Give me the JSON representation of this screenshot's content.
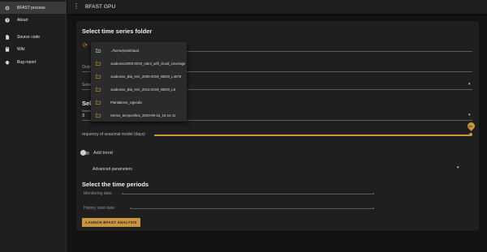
{
  "sidebar": {
    "items": [
      {
        "label": "BFAST process",
        "icon": "gear-icon"
      },
      {
        "label": "About",
        "icon": "help-icon"
      },
      {
        "label": "Source code",
        "icon": "file-icon"
      },
      {
        "label": "Wiki",
        "icon": "book-icon"
      },
      {
        "label": "Bug report",
        "icon": "bug-icon"
      }
    ]
  },
  "header": {
    "title": "BFAST GPU",
    "menu_icon": "kebab-menu-icon"
  },
  "form": {
    "folder_title": "Select time series folder",
    "output_label": "Outp",
    "select_label": "Selec",
    "sel_title_prefix": "Sele",
    "number_label": "Numbe",
    "number_value": "3",
    "frequency_label": "requency of seasonal model (days)",
    "frequency_value": "365",
    "add_trend_label": "Add trend",
    "advanced_label": "Advanced parameters",
    "periods_title": "Select the time periods",
    "monitoring_label": "Monitoring date:",
    "history_label": "History start date:",
    "launch_button": "LAUNCH BFAST ANALYSIS"
  },
  "folder_menu": {
    "items": [
      {
        "label": "../home/prambaud",
        "icon": "folder-up-icon"
      },
      {
        "label": "Juabosso2000-2019_ndmi_sdfi_cloud_coverage",
        "icon": "folder-icon"
      },
      {
        "label": "Juabosso_Bia_HIA_2000-2019_NDMI_L4578",
        "icon": "folder-icon"
      },
      {
        "label": "Juabosso_Bia_HIA_2013-2019_NDMI_L8",
        "icon": "folder-icon"
      },
      {
        "label": "Plantations_Ugenda",
        "icon": "folder-icon"
      },
      {
        "label": "Series_temporelles_2020-09-16_15-14-11",
        "icon": "folder-icon"
      }
    ]
  },
  "colors": {
    "accent": "#c8963e",
    "folder": "#d4a017"
  }
}
